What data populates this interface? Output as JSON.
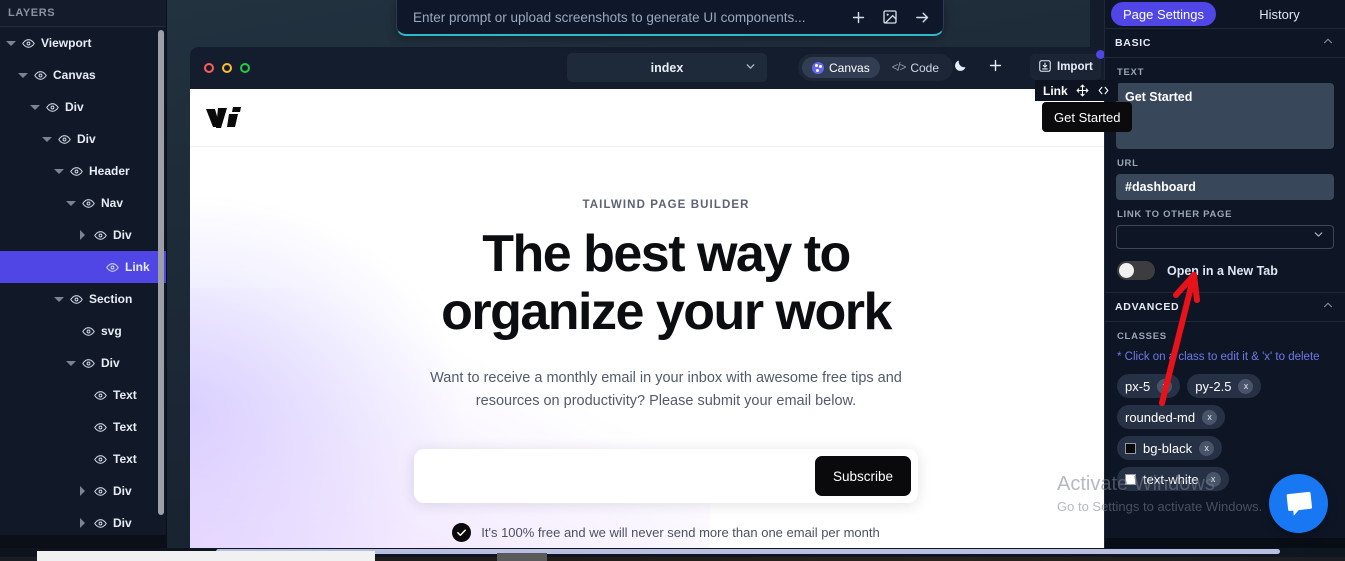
{
  "layers": {
    "title": "LAYERS",
    "items": [
      {
        "label": "Viewport",
        "depth": 0,
        "caret": "down",
        "selected": false
      },
      {
        "label": "Canvas",
        "depth": 1,
        "caret": "down",
        "selected": false
      },
      {
        "label": "Div",
        "depth": 2,
        "caret": "down",
        "selected": false
      },
      {
        "label": "Div",
        "depth": 3,
        "caret": "down",
        "selected": false
      },
      {
        "label": "Header",
        "depth": 4,
        "caret": "down",
        "selected": false
      },
      {
        "label": "Nav",
        "depth": 5,
        "caret": "down",
        "selected": false
      },
      {
        "label": "Div",
        "depth": 6,
        "caret": "right",
        "selected": false
      },
      {
        "label": "Link",
        "depth": 7,
        "caret": "none",
        "selected": true
      },
      {
        "label": "Section",
        "depth": 4,
        "caret": "down",
        "selected": false
      },
      {
        "label": "svg",
        "depth": 5,
        "caret": "none",
        "selected": false
      },
      {
        "label": "Div",
        "depth": 5,
        "caret": "down",
        "selected": false
      },
      {
        "label": "Text",
        "depth": 6,
        "caret": "none",
        "selected": false
      },
      {
        "label": "Text",
        "depth": 6,
        "caret": "none",
        "selected": false
      },
      {
        "label": "Text",
        "depth": 6,
        "caret": "none",
        "selected": false
      },
      {
        "label": "Div",
        "depth": 6,
        "caret": "right",
        "selected": false
      },
      {
        "label": "Div",
        "depth": 6,
        "caret": "right",
        "selected": false
      }
    ]
  },
  "prompt": {
    "placeholder": "Enter prompt or upload screenshots to generate UI components...",
    "icons": [
      "plus-icon",
      "image-icon",
      "arrow-right-icon"
    ]
  },
  "canvas_toolbar": {
    "page_name": "index",
    "mode_canvas": "Canvas",
    "mode_code": "Code",
    "theme_icon": "moon-icon",
    "add_icon": "plus-icon",
    "import_label": "Import"
  },
  "selection_overlay": {
    "badge_label": "Link",
    "element_label": "Get Started"
  },
  "page_content": {
    "logo": "vi-logo",
    "eyebrow": "TAILWIND PAGE BUILDER",
    "title": "The best way to organize your work",
    "subtitle": "Want to receive a monthly email in your inbox with awesome free tips and resources on productivity? Please submit your email below.",
    "email_value": "",
    "email_placeholder": "",
    "subscribe_label": "Subscribe",
    "note": "It's 100% free and we will never send more than one email per month"
  },
  "right_panel": {
    "tabs": [
      {
        "label": "Page Settings",
        "active": true
      },
      {
        "label": "History",
        "active": false
      }
    ],
    "basic": {
      "section_title": "BASIC",
      "text_label": "TEXT",
      "text_value": "Get Started",
      "url_label": "URL",
      "url_value": "#dashboard",
      "link_page_label": "LINK TO OTHER PAGE",
      "link_page_value": "",
      "new_tab_label": "Open in a New Tab",
      "new_tab_on": false
    },
    "advanced": {
      "section_title": "ADVANCED",
      "classes_label": "CLASSES",
      "classes_hint": "* Click on a class to edit it & 'x' to delete",
      "chips": [
        {
          "label": "px-5",
          "swatch": null
        },
        {
          "label": "py-2.5",
          "swatch": null
        },
        {
          "label": "rounded-md",
          "swatch": null
        },
        {
          "label": "bg-black",
          "swatch": "#0a0a0a"
        },
        {
          "label": "text-white",
          "swatch": "#ffffff"
        }
      ],
      "chip_remove": "x"
    }
  },
  "overlays": {
    "watermark_line1": "Activate Windows",
    "watermark_line2": "Go to Settings to activate Windows.",
    "chat_icon": "chat-bubble-icon",
    "arrow": "red-annotation-arrow"
  },
  "colors": {
    "accent": "#4f46e5",
    "panel_bg": "#0e1626",
    "canvas_chrome": "#141d2e",
    "chat_blue": "#1877f2",
    "annotation_red": "#e8131a"
  }
}
